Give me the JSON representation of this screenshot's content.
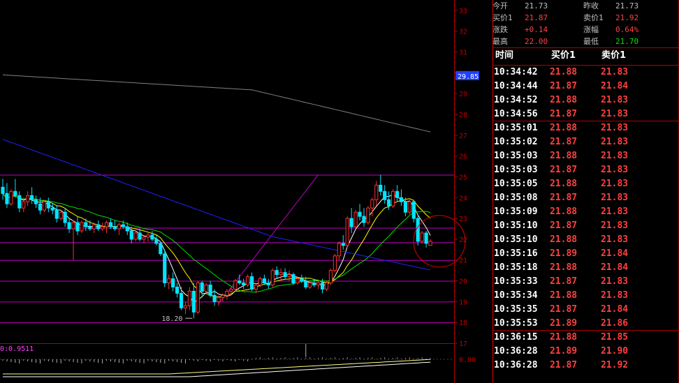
{
  "quote": {
    "rows": [
      {
        "l1": "今开",
        "v1": "21.73",
        "c1": "#c0c0c0",
        "l2": "昨收",
        "v2": "21.73",
        "c2": "#c0c0c0"
      },
      {
        "l1": "买价1",
        "v1": "21.87",
        "c1": "#ff4040",
        "l2": "卖价1",
        "v2": "21.92",
        "c2": "#ff4040"
      },
      {
        "l1": "涨跌",
        "v1": "+0.14",
        "c1": "#ff4040",
        "l2": "涨幅",
        "v2": "0.64%",
        "c2": "#ff4040"
      },
      {
        "l1": "最高",
        "v1": "22.00",
        "c1": "#ff4040",
        "l2": "最低",
        "v2": "21.70",
        "c2": "#00e000"
      }
    ]
  },
  "trades": {
    "headers": {
      "time": "时间",
      "buy": "买价1",
      "sell": "卖价1"
    },
    "rows": [
      {
        "time": "10:34:42",
        "buy": "21.88",
        "sell": "21.83"
      },
      {
        "time": "10:34:44",
        "buy": "21.87",
        "sell": "21.84"
      },
      {
        "time": "10:34:52",
        "buy": "21.88",
        "sell": "21.83"
      },
      {
        "time": "10:34:56",
        "buy": "21.87",
        "sell": "21.83"
      },
      {
        "time": "10:35:01",
        "buy": "21.88",
        "sell": "21.83"
      },
      {
        "time": "10:35:02",
        "buy": "21.87",
        "sell": "21.83"
      },
      {
        "time": "10:35:03",
        "buy": "21.88",
        "sell": "21.83"
      },
      {
        "time": "10:35:03",
        "buy": "21.87",
        "sell": "21.83"
      },
      {
        "time": "10:35:05",
        "buy": "21.88",
        "sell": "21.83"
      },
      {
        "time": "10:35:08",
        "buy": "21.87",
        "sell": "21.83"
      },
      {
        "time": "10:35:09",
        "buy": "21.88",
        "sell": "21.83"
      },
      {
        "time": "10:35:10",
        "buy": "21.87",
        "sell": "21.83"
      },
      {
        "time": "10:35:10",
        "buy": "21.88",
        "sell": "21.83"
      },
      {
        "time": "10:35:16",
        "buy": "21.89",
        "sell": "21.84"
      },
      {
        "time": "10:35:18",
        "buy": "21.88",
        "sell": "21.84"
      },
      {
        "time": "10:35:33",
        "buy": "21.87",
        "sell": "21.83"
      },
      {
        "time": "10:35:34",
        "buy": "21.88",
        "sell": "21.83"
      },
      {
        "time": "10:35:35",
        "buy": "21.87",
        "sell": "21.84"
      },
      {
        "time": "10:35:53",
        "buy": "21.89",
        "sell": "21.86"
      },
      {
        "time": "10:36:15",
        "buy": "21.88",
        "sell": "21.85"
      },
      {
        "time": "10:36:28",
        "buy": "21.89",
        "sell": "21.90"
      },
      {
        "time": "10:36:28",
        "buy": "21.87",
        "sell": "21.92"
      }
    ]
  },
  "chart_data": {
    "type": "candlestick",
    "ylim": [
      17,
      33.5
    ],
    "yticks": [
      17,
      18,
      19,
      20,
      21,
      22,
      23,
      24,
      25,
      26,
      27,
      28,
      29,
      30,
      31,
      32,
      33
    ],
    "current_price_label": "29.85",
    "current_price": 29.85,
    "low_annotation": {
      "label": "18.20",
      "index": 46,
      "value": 18.2
    },
    "horizontal_levels": [
      25.1,
      22.55,
      21.85,
      21.0,
      20.0,
      19.0,
      18.0
    ],
    "colors": {
      "up": "#ff3030",
      "down": "#00e5ff",
      "grid": "#c000c0",
      "axis": "#b00000",
      "ma5": "#ffffff",
      "ma10": "#ffff00",
      "ma20": "#00e000",
      "ma60": "#2020ff",
      "ma250": "#808080"
    },
    "candles": [
      [
        24.5,
        24.9,
        23.9,
        24.2
      ],
      [
        24.2,
        24.7,
        23.5,
        23.7
      ],
      [
        23.7,
        24.4,
        23.6,
        24.3
      ],
      [
        24.3,
        24.9,
        24.0,
        24.1
      ],
      [
        24.1,
        24.3,
        23.3,
        23.5
      ],
      [
        23.5,
        24.0,
        23.3,
        23.8
      ],
      [
        23.8,
        24.3,
        23.6,
        24.1
      ],
      [
        24.1,
        24.5,
        23.7,
        23.9
      ],
      [
        23.9,
        24.1,
        23.5,
        23.7
      ],
      [
        23.7,
        24.0,
        23.2,
        23.4
      ],
      [
        23.4,
        23.9,
        23.3,
        23.8
      ],
      [
        23.8,
        24.0,
        23.3,
        23.5
      ],
      [
        23.5,
        23.7,
        23.2,
        23.4
      ],
      [
        23.4,
        23.6,
        22.8,
        23.0
      ],
      [
        23.0,
        23.4,
        22.9,
        23.3
      ],
      [
        23.3,
        23.5,
        22.6,
        22.8
      ],
      [
        22.8,
        23.0,
        22.3,
        22.5
      ],
      [
        22.5,
        22.9,
        21.0,
        22.8
      ],
      [
        22.8,
        23.1,
        22.2,
        22.4
      ],
      [
        22.4,
        22.9,
        22.3,
        22.8
      ],
      [
        22.8,
        23.0,
        22.4,
        22.6
      ],
      [
        22.6,
        22.9,
        22.4,
        22.5
      ],
      [
        22.5,
        22.8,
        22.3,
        22.7
      ],
      [
        22.7,
        22.9,
        22.4,
        22.5
      ],
      [
        22.5,
        22.8,
        22.4,
        22.6
      ],
      [
        22.6,
        22.9,
        22.3,
        22.8
      ],
      [
        22.8,
        23.0,
        22.5,
        22.6
      ],
      [
        22.6,
        22.9,
        22.4,
        22.5
      ],
      [
        22.5,
        22.8,
        22.2,
        22.7
      ],
      [
        22.7,
        22.9,
        22.5,
        22.6
      ],
      [
        22.6,
        22.8,
        22.2,
        22.4
      ],
      [
        22.4,
        22.6,
        21.8,
        22.0
      ],
      [
        22.0,
        22.4,
        21.9,
        22.3
      ],
      [
        22.3,
        22.5,
        21.9,
        22.0
      ],
      [
        22.0,
        22.2,
        21.8,
        22.1
      ],
      [
        22.1,
        22.3,
        21.9,
        22.2
      ],
      [
        22.2,
        22.4,
        21.9,
        22.0
      ],
      [
        22.0,
        22.2,
        21.7,
        21.8
      ],
      [
        21.8,
        21.9,
        21.2,
        21.3
      ],
      [
        21.3,
        21.5,
        19.7,
        19.9
      ],
      [
        19.9,
        20.3,
        19.6,
        20.1
      ],
      [
        20.1,
        20.4,
        19.5,
        19.7
      ],
      [
        19.7,
        19.9,
        19.2,
        19.4
      ],
      [
        19.4,
        19.7,
        18.6,
        18.7
      ],
      [
        18.7,
        19.0,
        18.4,
        18.8
      ],
      [
        18.8,
        19.7,
        18.6,
        19.5
      ],
      [
        19.5,
        19.9,
        18.2,
        18.5
      ],
      [
        18.5,
        20.0,
        18.4,
        19.9
      ],
      [
        19.9,
        20.0,
        19.3,
        19.5
      ],
      [
        19.5,
        19.9,
        19.4,
        19.8
      ],
      [
        19.8,
        20.0,
        19.2,
        19.3
      ],
      [
        19.3,
        19.6,
        18.8,
        19.0
      ],
      [
        19.0,
        19.3,
        18.8,
        19.2
      ],
      [
        19.2,
        19.4,
        19.0,
        19.3
      ],
      [
        19.3,
        19.6,
        19.1,
        19.5
      ],
      [
        19.5,
        19.7,
        19.3,
        19.6
      ],
      [
        19.6,
        20.1,
        19.5,
        20.0
      ],
      [
        20.0,
        20.3,
        19.8,
        19.9
      ],
      [
        19.9,
        20.1,
        19.6,
        19.8
      ],
      [
        19.8,
        20.3,
        19.7,
        20.2
      ],
      [
        20.2,
        20.4,
        19.5,
        19.6
      ],
      [
        19.6,
        19.9,
        19.4,
        19.8
      ],
      [
        19.8,
        20.2,
        19.7,
        20.1
      ],
      [
        20.1,
        20.3,
        19.8,
        19.9
      ],
      [
        19.9,
        20.1,
        19.6,
        19.8
      ],
      [
        19.8,
        20.6,
        19.7,
        20.5
      ],
      [
        20.5,
        20.7,
        20.1,
        20.3
      ],
      [
        20.3,
        20.6,
        20.0,
        20.4
      ],
      [
        20.4,
        20.6,
        20.1,
        20.2
      ],
      [
        20.2,
        20.5,
        20.0,
        20.3
      ],
      [
        20.3,
        20.4,
        19.8,
        19.9
      ],
      [
        19.9,
        20.2,
        19.8,
        20.1
      ],
      [
        20.1,
        20.3,
        19.9,
        20.0
      ],
      [
        20.0,
        20.2,
        19.6,
        19.7
      ],
      [
        19.7,
        20.0,
        19.6,
        19.9
      ],
      [
        19.9,
        20.1,
        19.7,
        19.8
      ],
      [
        19.8,
        20.0,
        19.6,
        19.9
      ],
      [
        19.9,
        20.1,
        19.4,
        19.6
      ],
      [
        19.6,
        20.0,
        19.5,
        19.9
      ],
      [
        19.9,
        20.6,
        19.8,
        20.5
      ],
      [
        20.5,
        21.3,
        20.4,
        21.2
      ],
      [
        21.2,
        21.9,
        21.0,
        21.8
      ],
      [
        21.8,
        22.2,
        21.5,
        21.7
      ],
      [
        21.7,
        23.1,
        21.6,
        23.0
      ],
      [
        23.0,
        23.5,
        22.3,
        22.6
      ],
      [
        22.6,
        23.4,
        22.5,
        23.3
      ],
      [
        23.3,
        23.7,
        22.9,
        23.1
      ],
      [
        23.1,
        23.5,
        22.6,
        22.8
      ],
      [
        22.8,
        23.6,
        22.7,
        23.5
      ],
      [
        23.5,
        24.0,
        23.1,
        23.9
      ],
      [
        23.9,
        24.8,
        23.6,
        24.6
      ],
      [
        24.6,
        25.1,
        24.1,
        24.3
      ],
      [
        24.3,
        24.6,
        23.7,
        23.9
      ],
      [
        23.9,
        24.3,
        23.4,
        23.6
      ],
      [
        23.6,
        24.4,
        23.5,
        24.3
      ],
      [
        24.3,
        24.6,
        23.8,
        24.0
      ],
      [
        24.0,
        24.4,
        23.6,
        23.8
      ],
      [
        23.8,
        24.0,
        23.1,
        23.3
      ],
      [
        23.3,
        23.9,
        23.2,
        23.8
      ],
      [
        23.8,
        23.9,
        22.8,
        23.0
      ],
      [
        23.0,
        23.2,
        21.7,
        21.9
      ],
      [
        21.9,
        22.4,
        21.8,
        22.3
      ],
      [
        22.3,
        22.4,
        21.6,
        21.8
      ],
      [
        21.7,
        22.0,
        21.7,
        21.9
      ]
    ],
    "indicator": {
      "label": "0:0.9511",
      "zero_label": "0.00"
    }
  }
}
